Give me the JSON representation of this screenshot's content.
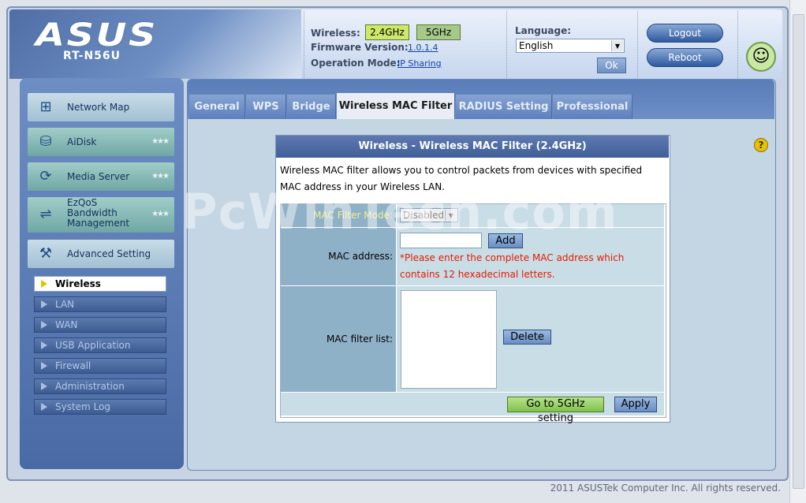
{
  "header": {
    "logo": "ASUS",
    "model": "RT-N56U",
    "wireless_label": "Wireless:",
    "band_24": "2.4GHz",
    "band_5": "5GHz",
    "firmware_label": "Firmware Version:",
    "firmware_value": "1.0.1.4",
    "opmode_label": "Operation Mode:",
    "opmode_value": "IP Sharing",
    "language_label": "Language:",
    "language_value": "English",
    "ok_label": "Ok",
    "logout_label": "Logout",
    "reboot_label": "Reboot"
  },
  "sidebar": {
    "items": [
      {
        "label": "Network Map"
      },
      {
        "label": "AiDisk"
      },
      {
        "label": "Media Server"
      },
      {
        "label": "EzQoS Bandwidth Management"
      },
      {
        "label": "Advanced Setting"
      }
    ],
    "sub_items": [
      {
        "label": "Wireless"
      },
      {
        "label": "LAN"
      },
      {
        "label": "WAN"
      },
      {
        "label": "USB Application"
      },
      {
        "label": "Firewall"
      },
      {
        "label": "Administration"
      },
      {
        "label": "System Log"
      }
    ]
  },
  "tabs": [
    "General",
    "WPS",
    "Bridge",
    "Wireless MAC Filter",
    "RADIUS Setting",
    "Professional"
  ],
  "panel": {
    "title": "Wireless - Wireless MAC Filter (2.4GHz)",
    "description": "Wireless MAC filter allows you to control packets from devices with specified MAC address in your Wireless LAN.",
    "filter_mode_label": "MAC Filter Mode:",
    "filter_mode_value": "Disabled",
    "mac_address_label": "MAC address:",
    "add_label": "Add",
    "mac_error": "*Please enter the complete MAC address which contains 12 hexadecimal letters.",
    "filter_list_label": "MAC filter list:",
    "delete_label": "Delete",
    "goto_5ghz_label": "Go to 5GHz setting",
    "apply_label": "Apply"
  },
  "watermark": "PcWinTech.com",
  "footer": "2011 ASUSTek Computer Inc. All rights reserved.",
  "colors": {
    "accent_blue": "#3f5e98",
    "band_active": "#cfe86a",
    "error_red": "#e11c00"
  }
}
